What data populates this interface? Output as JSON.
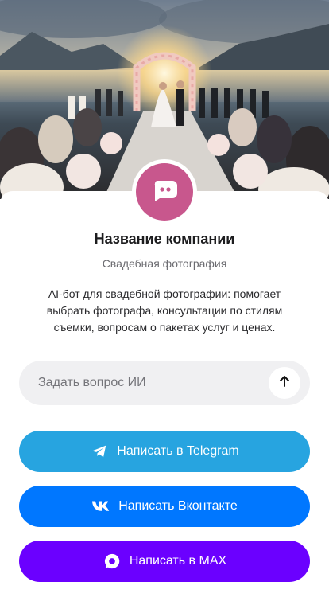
{
  "hero": {
    "image": "wedding-ceremony-photo"
  },
  "profile": {
    "avatar_icon": "chat-bubble-icon",
    "avatar_color": "#c8578d",
    "name": "Название компании",
    "subtitle": "Свадебная фотография",
    "description": "AI-бот для свадебной фотографии: помогает выбрать фотографа, консультации по стилям съемки, вопросам о пакетах услуг и ценах."
  },
  "ask": {
    "placeholder": "Задать вопрос ИИ",
    "send_icon": "arrow-up-icon"
  },
  "buttons": {
    "telegram": {
      "label": "Написать в Telegram",
      "icon": "telegram-icon",
      "color": "#27a4e0"
    },
    "vk": {
      "label": "Написать Вконтакте",
      "icon": "vk-icon",
      "color": "#0077ff"
    },
    "max": {
      "label": "Написать в MAX",
      "icon": "max-icon",
      "color": "#6b00ff"
    }
  }
}
